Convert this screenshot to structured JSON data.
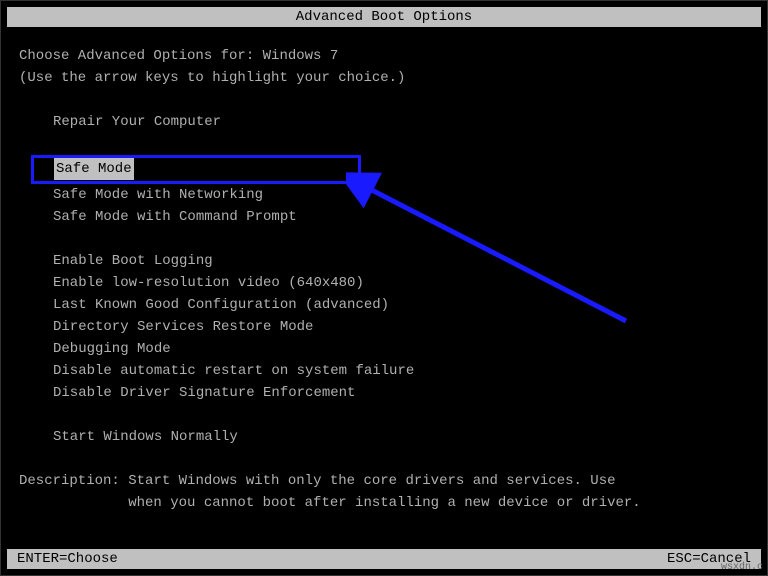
{
  "title": "Advanced Boot Options",
  "heading": "Choose Advanced Options for: Windows 7",
  "hint": "(Use the arrow keys to highlight your choice.)",
  "menu": {
    "group1": [
      "Repair Your Computer"
    ],
    "selected": "Safe Mode",
    "group2": [
      "Safe Mode with Networking",
      "Safe Mode with Command Prompt"
    ],
    "group3": [
      "Enable Boot Logging",
      "Enable low-resolution video (640x480)",
      "Last Known Good Configuration (advanced)",
      "Directory Services Restore Mode",
      "Debugging Mode",
      "Disable automatic restart on system failure",
      "Disable Driver Signature Enforcement"
    ],
    "group4": [
      "Start Windows Normally"
    ]
  },
  "description": {
    "label": "Description:",
    "line1": "Start Windows with only the core drivers and services. Use",
    "line2": "when you cannot boot after installing a new device or driver."
  },
  "footer": {
    "left": "ENTER=Choose",
    "right": "ESC=Cancel"
  },
  "annotation": {
    "arrow_color": "#1a1aff"
  },
  "watermark": "wsxdn.c"
}
